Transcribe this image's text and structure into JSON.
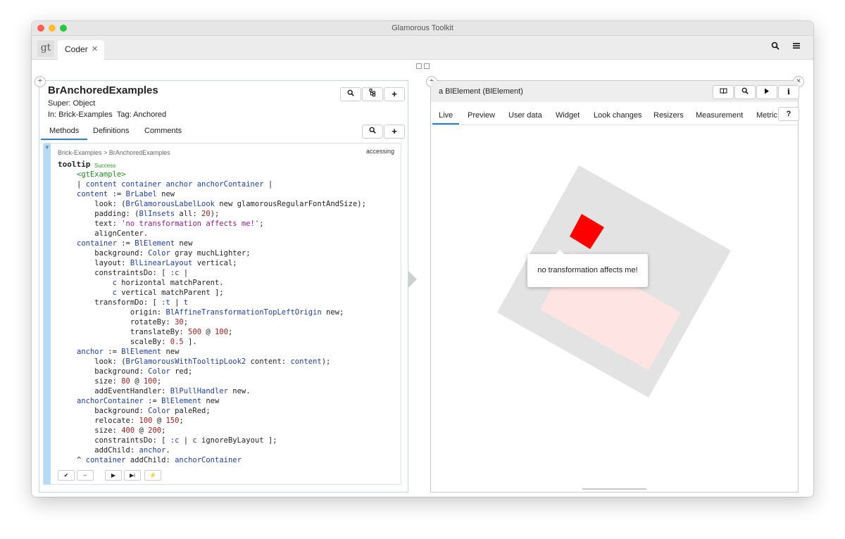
{
  "window": {
    "title": "Glamorous Toolkit"
  },
  "tabbar": {
    "logo": "gt",
    "tab_label": "Coder",
    "close_glyph": "✕",
    "search_icon": "search-icon",
    "menu_icon": "hamburger-menu-icon"
  },
  "left_pane": {
    "class_name": "BrAnchoredExamples",
    "super_line": "Super: Object",
    "in_line": "In: Brick-Examples",
    "tag_line": "Tag: Anchored",
    "tabs": [
      "Methods",
      "Definitions",
      "Comments"
    ],
    "breadcrumb": "Brick-Examples  >  BrAnchoredExamples",
    "category": "accessing",
    "selector": "tooltip",
    "status": "Success",
    "code_lines": [
      [
        [
          "<gtExample>",
          "p"
        ]
      ],
      [
        [
          "| ",
          ""
        ],
        [
          "content container anchor anchorContainer",
          "v"
        ],
        [
          " |",
          ""
        ]
      ],
      [
        [
          "content",
          "v"
        ],
        [
          " := ",
          ""
        ],
        [
          "BrLabel",
          "k"
        ],
        [
          " new",
          ""
        ]
      ],
      [
        [
          "    look: (",
          ""
        ],
        [
          "BrGlamorousLabelLook",
          "k"
        ],
        [
          " new glamorousRegularFontAndSize);",
          ""
        ]
      ],
      [
        [
          "    padding: (",
          ""
        ],
        [
          "BlInsets",
          "k"
        ],
        [
          " all: ",
          ""
        ],
        [
          "20",
          "n"
        ],
        [
          ");",
          ""
        ]
      ],
      [
        [
          "    text: ",
          ""
        ],
        [
          "'no transformation affects me!'",
          "s"
        ],
        [
          ";",
          ""
        ]
      ],
      [
        [
          "    alignCenter.",
          ""
        ]
      ],
      [
        [
          "container",
          "v"
        ],
        [
          " := ",
          ""
        ],
        [
          "BlElement",
          "k"
        ],
        [
          " new",
          ""
        ]
      ],
      [
        [
          "    background: ",
          ""
        ],
        [
          "Color",
          "k"
        ],
        [
          " gray muchLighter;",
          ""
        ]
      ],
      [
        [
          "    layout: ",
          ""
        ],
        [
          "BlLinearLayout",
          "k"
        ],
        [
          " vertical;",
          ""
        ]
      ],
      [
        [
          "    constraintsDo: [ ",
          ""
        ],
        [
          ":c",
          "v"
        ],
        [
          " |",
          ""
        ]
      ],
      [
        [
          "        ",
          ""
        ],
        [
          "c",
          "v"
        ],
        [
          " horizontal matchParent.",
          ""
        ]
      ],
      [
        [
          "        ",
          ""
        ],
        [
          "c",
          "v"
        ],
        [
          " vertical matchParent ];",
          ""
        ]
      ],
      [
        [
          "    transformDo: [ ",
          ""
        ],
        [
          ":t",
          "v"
        ],
        [
          " | ",
          ""
        ],
        [
          "t",
          "v"
        ]
      ],
      [
        [
          "            origin: ",
          ""
        ],
        [
          "BlAffineTransformationTopLeftOrigin",
          "k"
        ],
        [
          " new;",
          ""
        ]
      ],
      [
        [
          "            rotateBy: ",
          ""
        ],
        [
          "30",
          "n"
        ],
        [
          ";",
          ""
        ]
      ],
      [
        [
          "            translateBy: ",
          ""
        ],
        [
          "500",
          "n"
        ],
        [
          " @ ",
          ""
        ],
        [
          "100",
          "n"
        ],
        [
          ";",
          ""
        ]
      ],
      [
        [
          "            scaleBy: ",
          ""
        ],
        [
          "0.5",
          "n"
        ],
        [
          " ].",
          ""
        ]
      ],
      [
        [
          "anchor",
          "v"
        ],
        [
          " := ",
          ""
        ],
        [
          "BlElement",
          "k"
        ],
        [
          " new",
          ""
        ]
      ],
      [
        [
          "    look: (",
          ""
        ],
        [
          "BrGlamorousWithTooltipLook2",
          "k"
        ],
        [
          " content: ",
          ""
        ],
        [
          "content",
          "v"
        ],
        [
          ");",
          ""
        ]
      ],
      [
        [
          "    background: ",
          ""
        ],
        [
          "Color",
          "k"
        ],
        [
          " red;",
          ""
        ]
      ],
      [
        [
          "    size: ",
          ""
        ],
        [
          "80",
          "n"
        ],
        [
          " @ ",
          ""
        ],
        [
          "100",
          "n"
        ],
        [
          ";",
          ""
        ]
      ],
      [
        [
          "    addEventHandler: ",
          ""
        ],
        [
          "BlPullHandler",
          "k"
        ],
        [
          " new.",
          ""
        ]
      ],
      [
        [
          "anchorContainer",
          "v"
        ],
        [
          " := ",
          ""
        ],
        [
          "BlElement",
          "k"
        ],
        [
          " new",
          ""
        ]
      ],
      [
        [
          "    background: ",
          ""
        ],
        [
          "Color",
          "k"
        ],
        [
          " paleRed;",
          ""
        ]
      ],
      [
        [
          "    relocate: ",
          ""
        ],
        [
          "100",
          "n"
        ],
        [
          " @ ",
          ""
        ],
        [
          "150",
          "n"
        ],
        [
          ";",
          ""
        ]
      ],
      [
        [
          "    size: ",
          ""
        ],
        [
          "400",
          "n"
        ],
        [
          " @ ",
          ""
        ],
        [
          "200",
          "n"
        ],
        [
          ";",
          ""
        ]
      ],
      [
        [
          "    constraintsDo: [ ",
          ""
        ],
        [
          ":c",
          "v"
        ],
        [
          " | ",
          ""
        ],
        [
          "c",
          "v"
        ],
        [
          " ignoreByLayout ];",
          ""
        ]
      ],
      [
        [
          "    addChild: ",
          ""
        ],
        [
          "anchor",
          "v"
        ],
        [
          ".",
          ""
        ]
      ],
      [
        [
          "^ ",
          ""
        ],
        [
          "container",
          "v"
        ],
        [
          " addChild: ",
          ""
        ],
        [
          "anchorContainer",
          "v"
        ]
      ]
    ],
    "mini_buttons": [
      "✔",
      "–",
      "▶",
      "▶i",
      "⚡"
    ]
  },
  "right_pane": {
    "title": "a BlElement (BlElement)",
    "tabs": [
      "Live",
      "Preview",
      "User data",
      "Widget",
      "Look changes",
      "Resizers",
      "Measurement",
      "Metric"
    ],
    "help_label": "?",
    "tooltip_text": "no transformation affects me!",
    "colors": {
      "gray": "#e3e3e3",
      "red": "#ff0000",
      "pale_red": "#ffe4e4"
    }
  }
}
